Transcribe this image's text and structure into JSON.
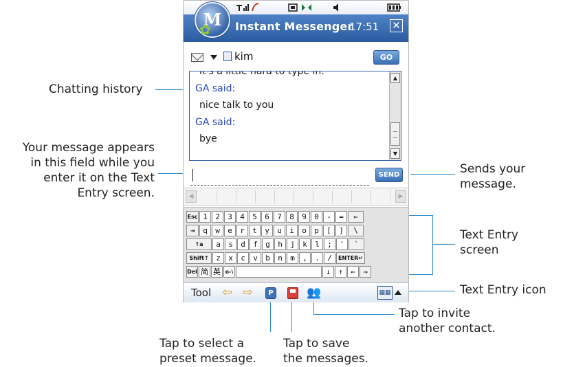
{
  "status_bar": {
    "icons": [
      "signal-icon",
      "call-icon",
      "data-icon",
      "bluetooth-icon",
      "speaker-icon",
      "battery-icon"
    ]
  },
  "title_bar": {
    "app_title": "Instant Messenger",
    "clock": "17:51",
    "logo_letter": "M"
  },
  "recipient": {
    "name": "kim",
    "go_label": "GO"
  },
  "history": [
    {
      "kind": "msg",
      "text": "It's a little hard to type in."
    },
    {
      "kind": "speaker",
      "text": "GA said:"
    },
    {
      "kind": "msg",
      "text": "nice talk to you"
    },
    {
      "kind": "speaker",
      "text": "GA said:"
    },
    {
      "kind": "msg",
      "text": "bye"
    }
  ],
  "message": {
    "value": "",
    "send_label": "SEND"
  },
  "keyboard": {
    "row1": [
      "Esc",
      "1",
      "2",
      "3",
      "4",
      "5",
      "6",
      "7",
      "8",
      "9",
      "0",
      "-",
      "=",
      "←"
    ],
    "row2": [
      "⇥",
      "q",
      "w",
      "e",
      "r",
      "t",
      "y",
      "u",
      "i",
      "o",
      "p",
      "[",
      "]",
      "\\"
    ],
    "row3": [
      "↑a",
      "a",
      "s",
      "d",
      "f",
      "g",
      "h",
      "j",
      "k",
      "l",
      ";",
      "'",
      "`"
    ],
    "row4": [
      "Shift↑",
      "z",
      "x",
      "c",
      "v",
      "b",
      "n",
      "m",
      ",",
      ".",
      "/",
      "ENTER↵"
    ],
    "row5": [
      "Del",
      "简",
      "英",
      "o-\\",
      "",
      "↓",
      "↑",
      "←",
      "→"
    ]
  },
  "bottom_bar": {
    "tool_label": "Tool",
    "preset_letter": "P"
  },
  "callouts": {
    "chatting_history": "Chatting history",
    "message_field": [
      "Your message appears",
      "in this field while you",
      "enter it on the Text",
      "Entry screen."
    ],
    "send": [
      "Sends your",
      "message."
    ],
    "text_entry_screen": [
      "Text Entry",
      "screen"
    ],
    "text_entry_icon": "Text Entry icon",
    "invite": [
      "Tap to invite",
      "another contact."
    ],
    "preset": [
      "Tap to select a",
      "preset message."
    ],
    "save": [
      "Tap to save",
      "the messages."
    ]
  }
}
